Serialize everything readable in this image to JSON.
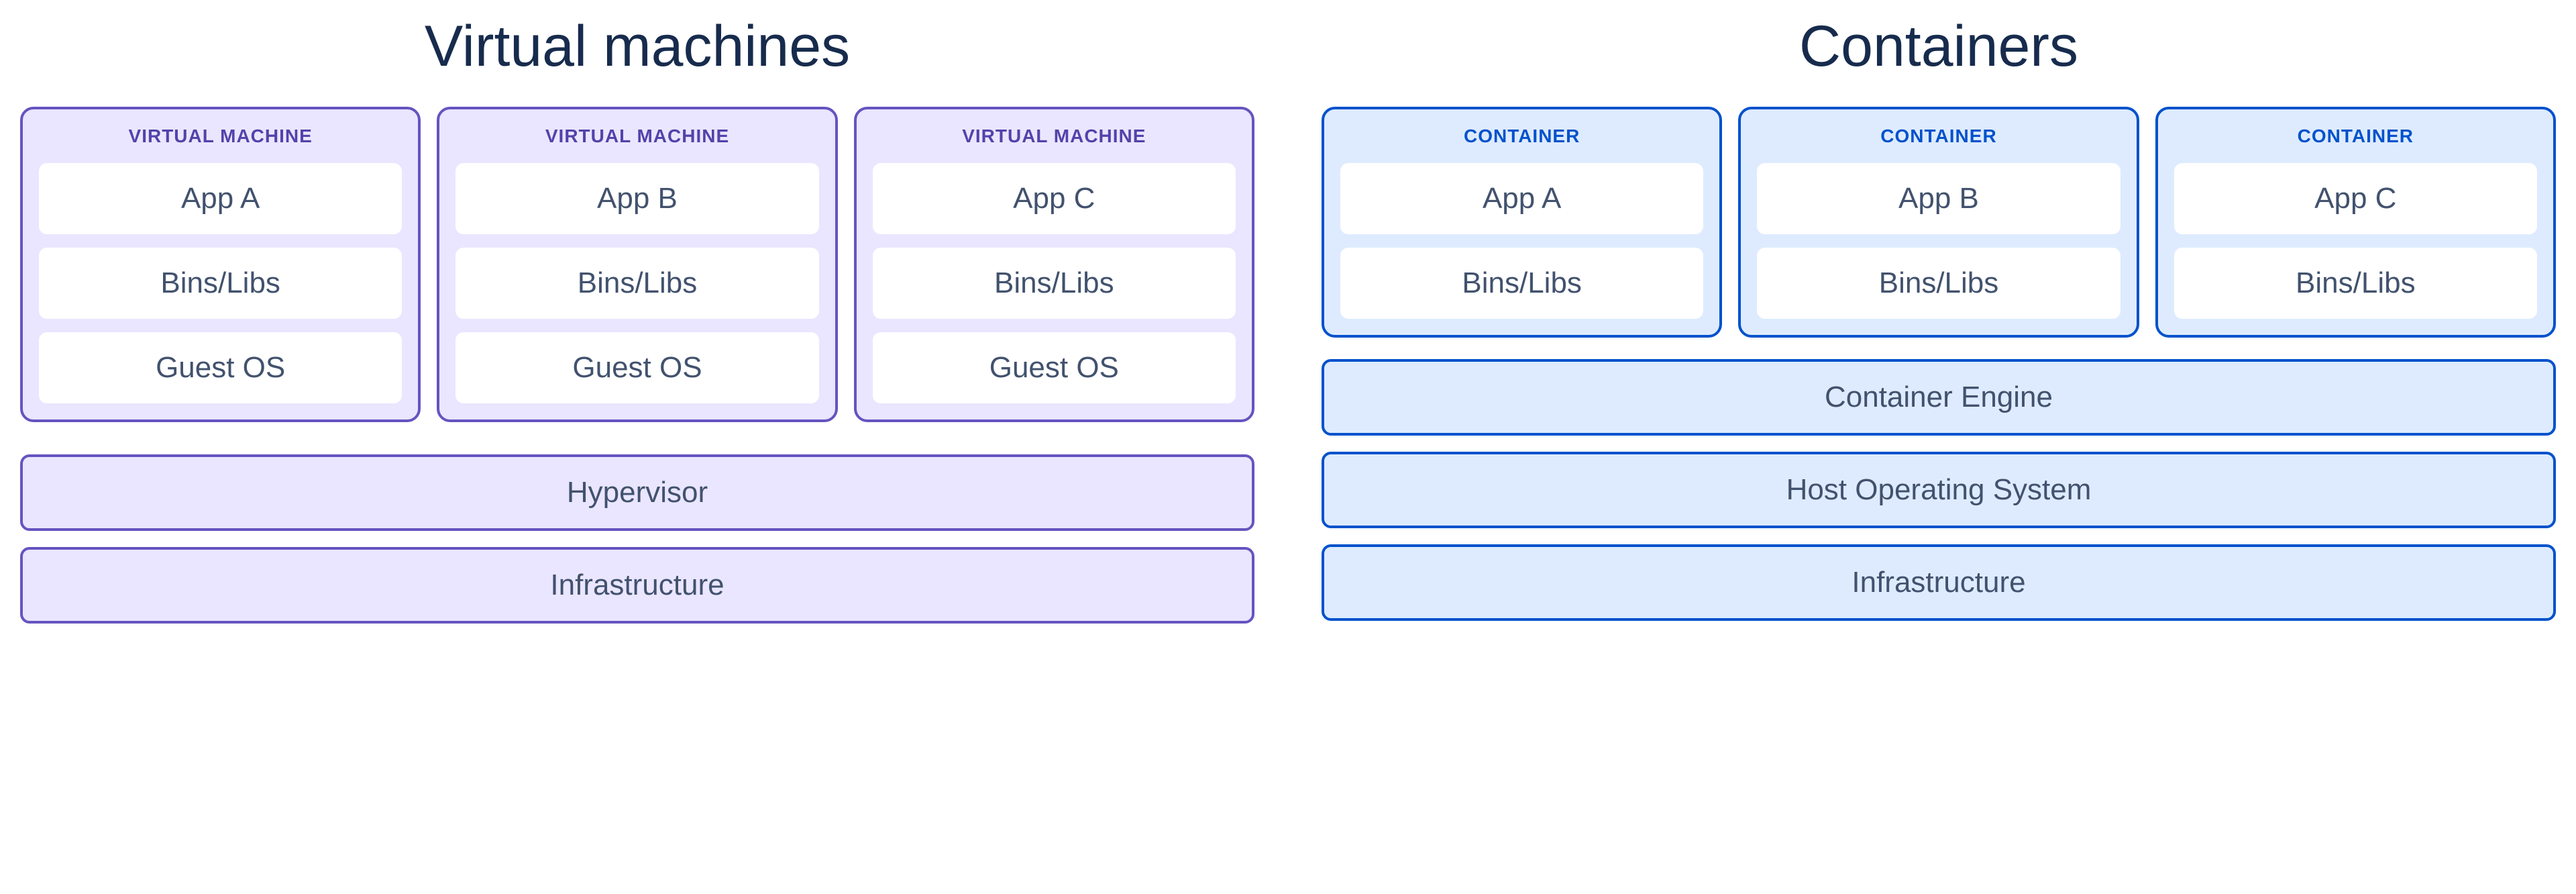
{
  "vm": {
    "title": "Virtual machines",
    "unit_label": "VIRTUAL MACHINE",
    "units": [
      {
        "app": "App A",
        "bins": "Bins/Libs",
        "os": "Guest OS"
      },
      {
        "app": "App B",
        "bins": "Bins/Libs",
        "os": "Guest OS"
      },
      {
        "app": "App C",
        "bins": "Bins/Libs",
        "os": "Guest OS"
      }
    ],
    "layers": [
      "Hypervisor",
      "Infrastructure"
    ]
  },
  "ct": {
    "title": "Containers",
    "unit_label": "CONTAINER",
    "units": [
      {
        "app": "App A",
        "bins": "Bins/Libs"
      },
      {
        "app": "App B",
        "bins": "Bins/Libs"
      },
      {
        "app": "App C",
        "bins": "Bins/Libs"
      }
    ],
    "layers": [
      "Container Engine",
      "Host Operating System",
      "Infrastructure"
    ]
  },
  "colors": {
    "vm_bg": "#EAE6FF",
    "vm_border": "#6554C0",
    "ct_bg": "#DEEBFF",
    "ct_border": "#0052CC",
    "text": "#42526E",
    "title": "#172B4D"
  }
}
